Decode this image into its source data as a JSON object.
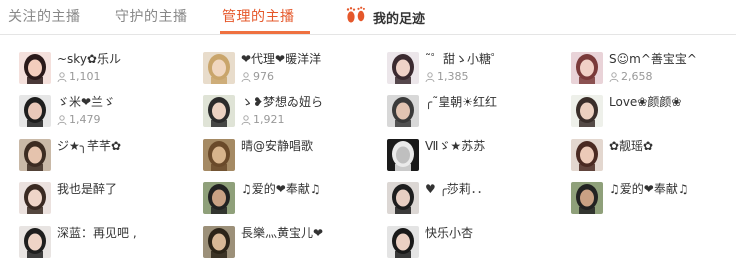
{
  "tabs": [
    {
      "label": "关注的主播",
      "active": false
    },
    {
      "label": "守护的主播",
      "active": false
    },
    {
      "label": "管理的主播",
      "active": true
    }
  ],
  "footprint": {
    "label": "我的足迹",
    "icon": "footprint-icon",
    "color": "#e5582b"
  },
  "accent_color": "#ef7140",
  "anchors": [
    {
      "name": "~sky✿乐ル",
      "count": "1,101",
      "avatar": {
        "bg": "#f4e0dc",
        "hair": "#2a1a1a",
        "skin": "#f3cdbd"
      }
    },
    {
      "name": "❤代理❤暖洋洋",
      "count": "976",
      "avatar": {
        "bg": "#e8dccb",
        "hair": "#c9a56b",
        "skin": "#f0d6bf"
      }
    },
    {
      "name": "˜゜甜ゝ小糖゜",
      "count": "1,385",
      "avatar": {
        "bg": "#ece6ea",
        "hair": "#3b2a30",
        "skin": "#efd2c8"
      }
    },
    {
      "name": "S☺m^善宝宝^",
      "count": "2,658",
      "avatar": {
        "bg": "#e9d3d8",
        "hair": "#7a3a3a",
        "skin": "#f1d0c6"
      }
    },
    {
      "name": "ゞ米❤兰ゞ",
      "count": "1,479",
      "avatar": {
        "bg": "#e6e6e6",
        "hair": "#1e1e1e",
        "skin": "#e9c8b9"
      }
    },
    {
      "name": "ゝ❥梦想ゐ妞ら",
      "count": "1,921",
      "avatar": {
        "bg": "#dfe3d6",
        "hair": "#2b2b2b",
        "skin": "#ecd2c2"
      }
    },
    {
      "name": "╭˜皇朝☀红红",
      "count": "",
      "avatar": {
        "bg": "#d8d8d8",
        "hair": "#3a3a3a",
        "skin": "#e2c4b2"
      }
    },
    {
      "name": "Love❀颜颜❀",
      "count": "",
      "avatar": {
        "bg": "#eef0ea",
        "hair": "#3a2e2a",
        "skin": "#ecd0c0"
      }
    },
    {
      "name": "ジ★╮芊芊✿",
      "count": "",
      "avatar": {
        "bg": "#c9b9a7",
        "hair": "#3c2c22",
        "skin": "#e5c3ad"
      }
    },
    {
      "name": "晴@安静唱歌",
      "count": "",
      "avatar": {
        "bg": "#a58a64",
        "hair": "#6a4a2a",
        "skin": "#d7b48c"
      }
    },
    {
      "name": "Ⅶゞ★苏苏",
      "count": "",
      "avatar": {
        "bg": "#1a1a1a",
        "hair": "#eaeaea",
        "skin": "#bfbfbf"
      }
    },
    {
      "name": "✿靓瑶✿",
      "count": "",
      "avatar": {
        "bg": "#e3d7cf",
        "hair": "#4a2a22",
        "skin": "#eccab8"
      }
    },
    {
      "name": "我也是醉了",
      "count": "",
      "avatar": {
        "bg": "#ebe1de",
        "hair": "#3a2a22",
        "skin": "#efd5c8"
      }
    },
    {
      "name": "♫爱的❤奉献♫",
      "count": "",
      "avatar": {
        "bg": "#8fa07a",
        "hair": "#222222",
        "skin": "#c9a184"
      }
    },
    {
      "name": "♥ ╭莎莉．．",
      "count": "",
      "avatar": {
        "bg": "#dcd7d4",
        "hair": "#1e1e1e",
        "skin": "#e8cfc3"
      }
    },
    {
      "name": "♫爱的❤奉献♫",
      "count": "",
      "avatar": {
        "bg": "#8fa07a",
        "hair": "#222222",
        "skin": "#c9a184"
      }
    },
    {
      "name": "深蓝：再见吧 ,",
      "count": "",
      "avatar": {
        "bg": "#e8e4e2",
        "hair": "#1e1e1e",
        "skin": "#eed4c6"
      }
    },
    {
      "name": "長樂灬黄宝儿❤",
      "count": "",
      "avatar": {
        "bg": "#9c9079",
        "hair": "#2c2418",
        "skin": "#d8b896"
      }
    },
    {
      "name": "快乐小杏",
      "count": "",
      "avatar": {
        "bg": "#e4e4e4",
        "hair": "#1a1a1a",
        "skin": "#ebd0c3"
      }
    }
  ]
}
